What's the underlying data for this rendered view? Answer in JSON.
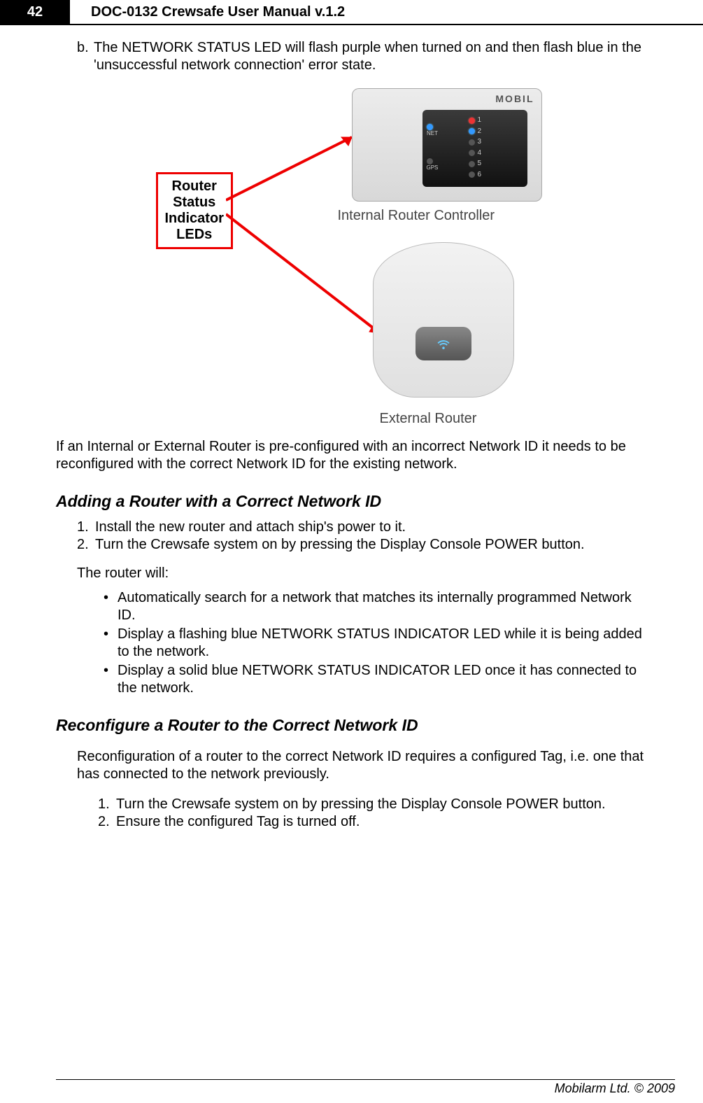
{
  "header": {
    "page_number": "42",
    "doc_title": "DOC-0132 Crewsafe User Manual v.1.2"
  },
  "body": {
    "item_b_marker": "b.",
    "item_b_text": "The NETWORK STATUS LED will flash purple when turned on and then flash blue in the 'unsuccessful network connection' error state.",
    "figure": {
      "callout_lines": [
        "Router",
        "Status",
        "Indicator",
        "LEDs"
      ],
      "top_brand": "MOBIL",
      "net_label": "NET",
      "gps_label": "GPS",
      "led_numbers": [
        "1",
        "2",
        "3",
        "4",
        "5",
        "6"
      ],
      "top_device_label": "Internal Router Controller",
      "bottom_device_label": "External Router"
    },
    "para_after_figure": "If an Internal or External Router is pre-configured with an incorrect Network ID it needs to be reconfigured with the correct Network ID for the existing network.",
    "section1_heading": "Adding a Router with a Correct Network ID",
    "section1_steps": [
      "Install the new router and attach ship's power to it.",
      "Turn the Crewsafe system on by pressing the Display Console POWER button."
    ],
    "section1_subpara": "The router will:",
    "section1_bullets": [
      "Automatically search for a network that matches its internally programmed Network ID.",
      "Display a flashing blue NETWORK STATUS INDICATOR LED while it is being added to the network.",
      "Display a solid blue NETWORK STATUS INDICATOR LED once it has connected to the network."
    ],
    "section2_heading": "Reconfigure a Router to the Correct Network ID",
    "section2_intro": "Reconfiguration of a router to the correct Network ID requires a configured Tag, i.e. one that has connected to the network previously.",
    "section2_steps": [
      "Turn the Crewsafe system on by pressing the Display Console POWER button.",
      "Ensure the configured Tag is turned off."
    ]
  },
  "footer": {
    "text": "Mobilarm Ltd. © 2009"
  }
}
